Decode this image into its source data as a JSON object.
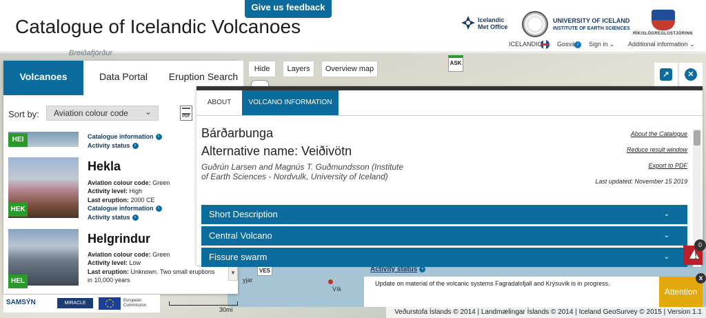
{
  "header": {
    "title": "Catalogue of Icelandic Volcanoes",
    "feedback_label": "Give us feedback",
    "imo_logo_text": "Icelandic Met Office",
    "ui_name": "UNIVERSITY OF ICELAND",
    "ui_sub": "INSTITUTE OF EARTH SCIENCES",
    "police_text": "RÍKISLÖGREGLUSTJÓRINN",
    "language_label": "ICELANDIC",
    "gosva_label": "Gosvá",
    "signin_label": "Sign in",
    "additional_info_label": "Additional information"
  },
  "map": {
    "coast_label": "Breiðafjörður",
    "marker_ask": "ASK",
    "marker_ves": "VES",
    "place_vik": "Vík",
    "place_town": "yjar",
    "activity_status_label": "Activity status",
    "scale_label": "30mi",
    "footer": "Veðurstofa Íslands © 2014 | Landmælingar Íslands © 2014 | Iceland GeoSurvey © 2015 | Version 1.1"
  },
  "map_tools": {
    "hide_label": "Hide",
    "layers_label": "Layers",
    "overview_label": "Overview map",
    "expand_icon": "↗",
    "close_icon": "✕"
  },
  "left_panel": {
    "tabs": [
      {
        "label": "Volcanoes"
      },
      {
        "label": "Data Portal"
      },
      {
        "label": "Eruption Search"
      }
    ],
    "sort_label": "Sort by:",
    "sort_value": "Aviation colour code",
    "pdf_label": "PDF",
    "volcanoes": [
      {
        "code": "HEI",
        "catalogue_info": "Catalogue information",
        "activity_status": "Activity status"
      },
      {
        "code": "HEK",
        "name": "Hekla",
        "aviation_label": "Aviation colour code:",
        "aviation_value": "Green",
        "activity_label": "Activity level:",
        "activity_value": "High",
        "last_label": "Last eruption:",
        "last_value": "2000 CE",
        "catalogue_info": "Catalogue information",
        "activity_status": "Activity status"
      },
      {
        "code": "HEL",
        "name": "Helgrindur",
        "aviation_label": "Aviation colour code:",
        "aviation_value": "Green",
        "activity_label": "Activity level:",
        "activity_value": "Low",
        "last_label": "Last eruption:",
        "last_value": "Unknown. Two small eruptions in 10,000 years"
      }
    ],
    "partners": {
      "samsyn": "SAMSÝN",
      "miracle": "MIRACLE",
      "eu_text": "European Commission"
    }
  },
  "info_panel": {
    "tabs": [
      {
        "label": "ABOUT"
      },
      {
        "label": "VOLCANO INFORMATION"
      }
    ],
    "volcano_name": "Bárðarbunga",
    "alt_name": "Alternative name: Veiðivötn",
    "authors": "Guðrún Larsen and Magnús T. Guðmundsson (Institute of Earth Sciences - Nordvulk, University of Iceland)",
    "links": {
      "about": "About the Catalogue",
      "reduce": "Reduce result window",
      "export": "Export to PDF"
    },
    "last_updated": "Last updated: November 15 2019",
    "sections": [
      {
        "label": "Short Description"
      },
      {
        "label": "Central Volcano"
      },
      {
        "label": "Fissure swarm"
      }
    ]
  },
  "alerts": {
    "count": "0",
    "update_text": "Update on material of the volcanic systems Fagradalsfjall and Krýsuvík is in progress.",
    "attention_label": "Attention",
    "close_label": "x"
  },
  "colors": {
    "primary": "#0d6c9e",
    "green_code": "#2a9a2a",
    "alert_red": "#b8212b",
    "attention_yellow": "#e3a90c"
  }
}
